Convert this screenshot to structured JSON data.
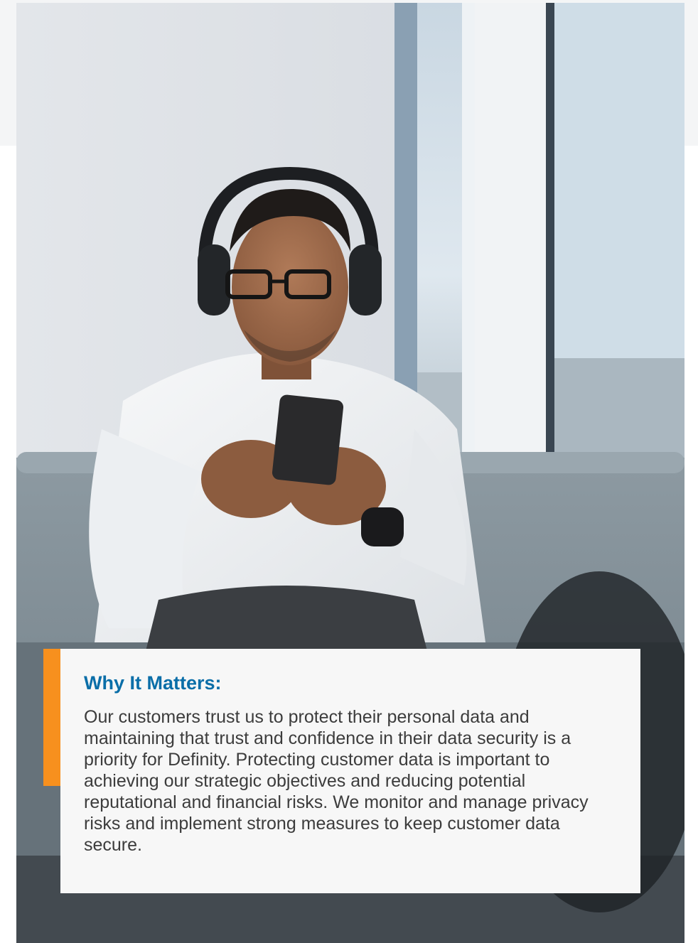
{
  "callout": {
    "heading": "Why It Matters:",
    "body": "Our customers trust us to protect their personal data and maintaining that trust and confidence in their data security is a priority for Definity. Protecting customer data is important to achieving our strategic objectives and reducing potential reputational and financial risks. We monitor and manage privacy risks and implement strong measures to keep customer data secure."
  },
  "photo": {
    "subject": "man-wearing-headphones-using-phone-on-sofa"
  },
  "colors": {
    "accent": "#f7901e",
    "heading": "#0a6ea8",
    "body_text": "#3c3c3c",
    "callout_bg": "#f7f7f7"
  }
}
